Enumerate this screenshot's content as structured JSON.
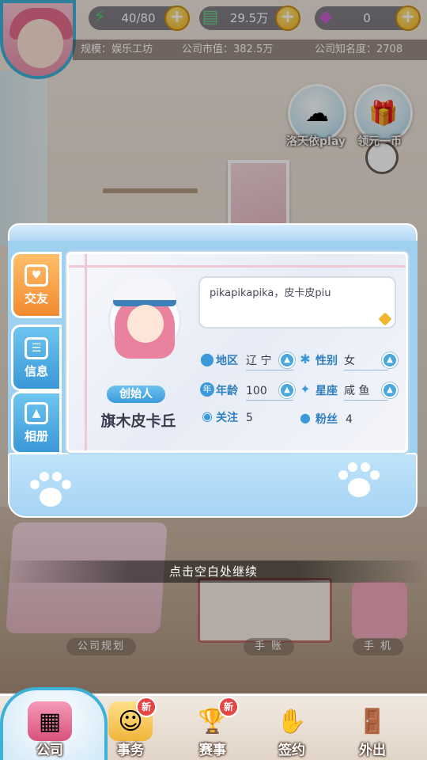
{
  "resources": {
    "energy": "40/80",
    "money": "29.5万",
    "gems": "0"
  },
  "company": {
    "scale": "规模：娱乐工坊",
    "market_value": "公司市值：382.5万",
    "reputation": "公司知名度：2708"
  },
  "side_buttons": {
    "luo_tianyi": "洛天依play",
    "claim_coin": "领元一币"
  },
  "tabs": {
    "friend": "交友",
    "info": "信息",
    "album": "相册"
  },
  "profile": {
    "role": "创始人",
    "name": "旗木皮卡丘",
    "bio": "pikapikapika，皮卡皮piu",
    "region_label": "地区",
    "region_value": "辽 宁",
    "gender_label": "性别",
    "gender_value": "女",
    "age_label": "年龄",
    "age_value": "100",
    "zodiac_label": "星座",
    "zodiac_value": "咸 鱼",
    "follow_label": "关注",
    "follow_value": "5",
    "fans_label": "粉丝",
    "fans_value": "4"
  },
  "hint": "点击空白处继续",
  "bg_labels": {
    "plan": "公司规划",
    "notebook": "手 账",
    "phone": "手 机"
  },
  "nav": {
    "company": "公司",
    "affairs": "事务",
    "match": "赛事",
    "contract": "签约",
    "outing": "外出",
    "new_badge": "新"
  },
  "colors": {
    "accent_blue": "#3a98d8",
    "tab_orange": "#f28a2f",
    "gold": "#f3b21b"
  },
  "icons": {
    "energy": "lightning-icon",
    "money": "cash-icon",
    "gems": "gem-icon"
  }
}
